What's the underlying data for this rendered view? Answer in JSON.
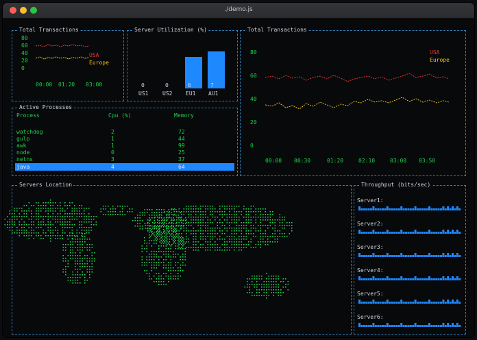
{
  "window": {
    "title": "./demo.js",
    "traffic_lights": {
      "close": "#ff5f57",
      "minimize": "#febc2e",
      "maximize": "#28c840"
    }
  },
  "colors": {
    "border": "#2f7fb8",
    "green": "#1fd14a",
    "usa": "#e53935",
    "europe": "#f0c419",
    "bar": "#1e88ff",
    "selection": "#1e88ff"
  },
  "panels": {
    "tx_small": {
      "label": "Total Transactions",
      "y_ticks": [
        "80",
        "60",
        "40",
        "20",
        "0"
      ],
      "x_ticks": [
        "00:00",
        "01:20",
        "03:00"
      ],
      "legend": [
        "USA",
        "Europe"
      ]
    },
    "server_util": {
      "label": "Server Utilization (%)",
      "bars": [
        {
          "name": "US1",
          "value": 0
        },
        {
          "name": "US2",
          "value": 0
        },
        {
          "name": "EU1",
          "value": 6
        },
        {
          "name": "AU1",
          "value": 7
        }
      ]
    },
    "tx_large": {
      "label": "Total Transactions",
      "y_ticks": [
        "80",
        "60",
        "40",
        "20",
        "0"
      ],
      "x_ticks": [
        "00:00",
        "00:30",
        "01:20",
        "02:10",
        "03:00",
        "03:50"
      ],
      "legend": [
        "USA",
        "Europe"
      ]
    },
    "processes": {
      "label": "Active Processes",
      "headers": [
        "Process",
        "Cpu (%)",
        "Memory"
      ],
      "rows": [
        [
          "watchdog",
          "2",
          "72"
        ],
        [
          "gulp",
          "1",
          "44"
        ],
        [
          "awk",
          "1",
          "99"
        ],
        [
          "node",
          "0",
          "25"
        ],
        [
          "netns",
          "3",
          "37"
        ],
        [
          "java",
          "4",
          "64"
        ]
      ],
      "selected_index": 5
    },
    "map": {
      "label": "Servers Location"
    },
    "throughput": {
      "label": "Throughput (bits/sec)",
      "servers": [
        "Server1:",
        "Server2:",
        "Server3:",
        "Server4:",
        "Server5:",
        "Server6:"
      ]
    }
  }
}
